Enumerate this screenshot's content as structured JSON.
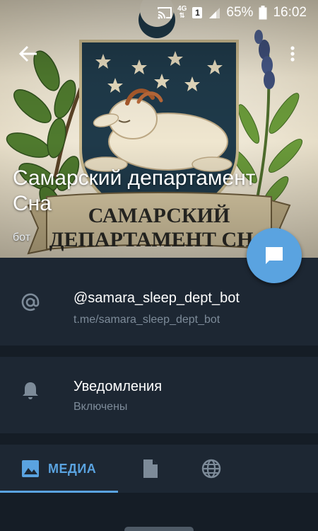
{
  "status_bar": {
    "network": "4G",
    "sim": "1",
    "battery": "65%",
    "time": "16:02",
    "icons": [
      "cast-icon",
      "signal-icon",
      "battery-icon"
    ]
  },
  "header": {
    "back_icon": "arrow-left-icon",
    "menu_icon": "more-vertical-icon",
    "name": "Самарский департамент Сна",
    "subtitle": "бот",
    "emblem": {
      "ribbon_line1": "САМАРСКИЙ",
      "ribbon_line2": "ДЕПАРТАМЕНТ СНА",
      "description_colors": {
        "shield": "#1f3a4a",
        "goat": "#efe6cf",
        "ribbon": "#d8c9a4"
      }
    }
  },
  "fab": {
    "icon": "chat-icon",
    "color": "#5aa3e0"
  },
  "info": {
    "username": "@samara_sleep_dept_bot",
    "username_link": "t.me/samara_sleep_dept_bot",
    "notifications_title": "Уведомления",
    "notifications_status": "Включены"
  },
  "tabs": [
    {
      "label": "МЕДИА",
      "icon": "image-icon",
      "active": true
    },
    {
      "label": "",
      "icon": "file-icon",
      "active": false
    },
    {
      "label": "",
      "icon": "globe-icon",
      "active": false
    }
  ],
  "colors": {
    "accent": "#5aa3e0",
    "background": "#1d2733",
    "divider": "#151d26",
    "secondary_text": "#7d8b99"
  }
}
